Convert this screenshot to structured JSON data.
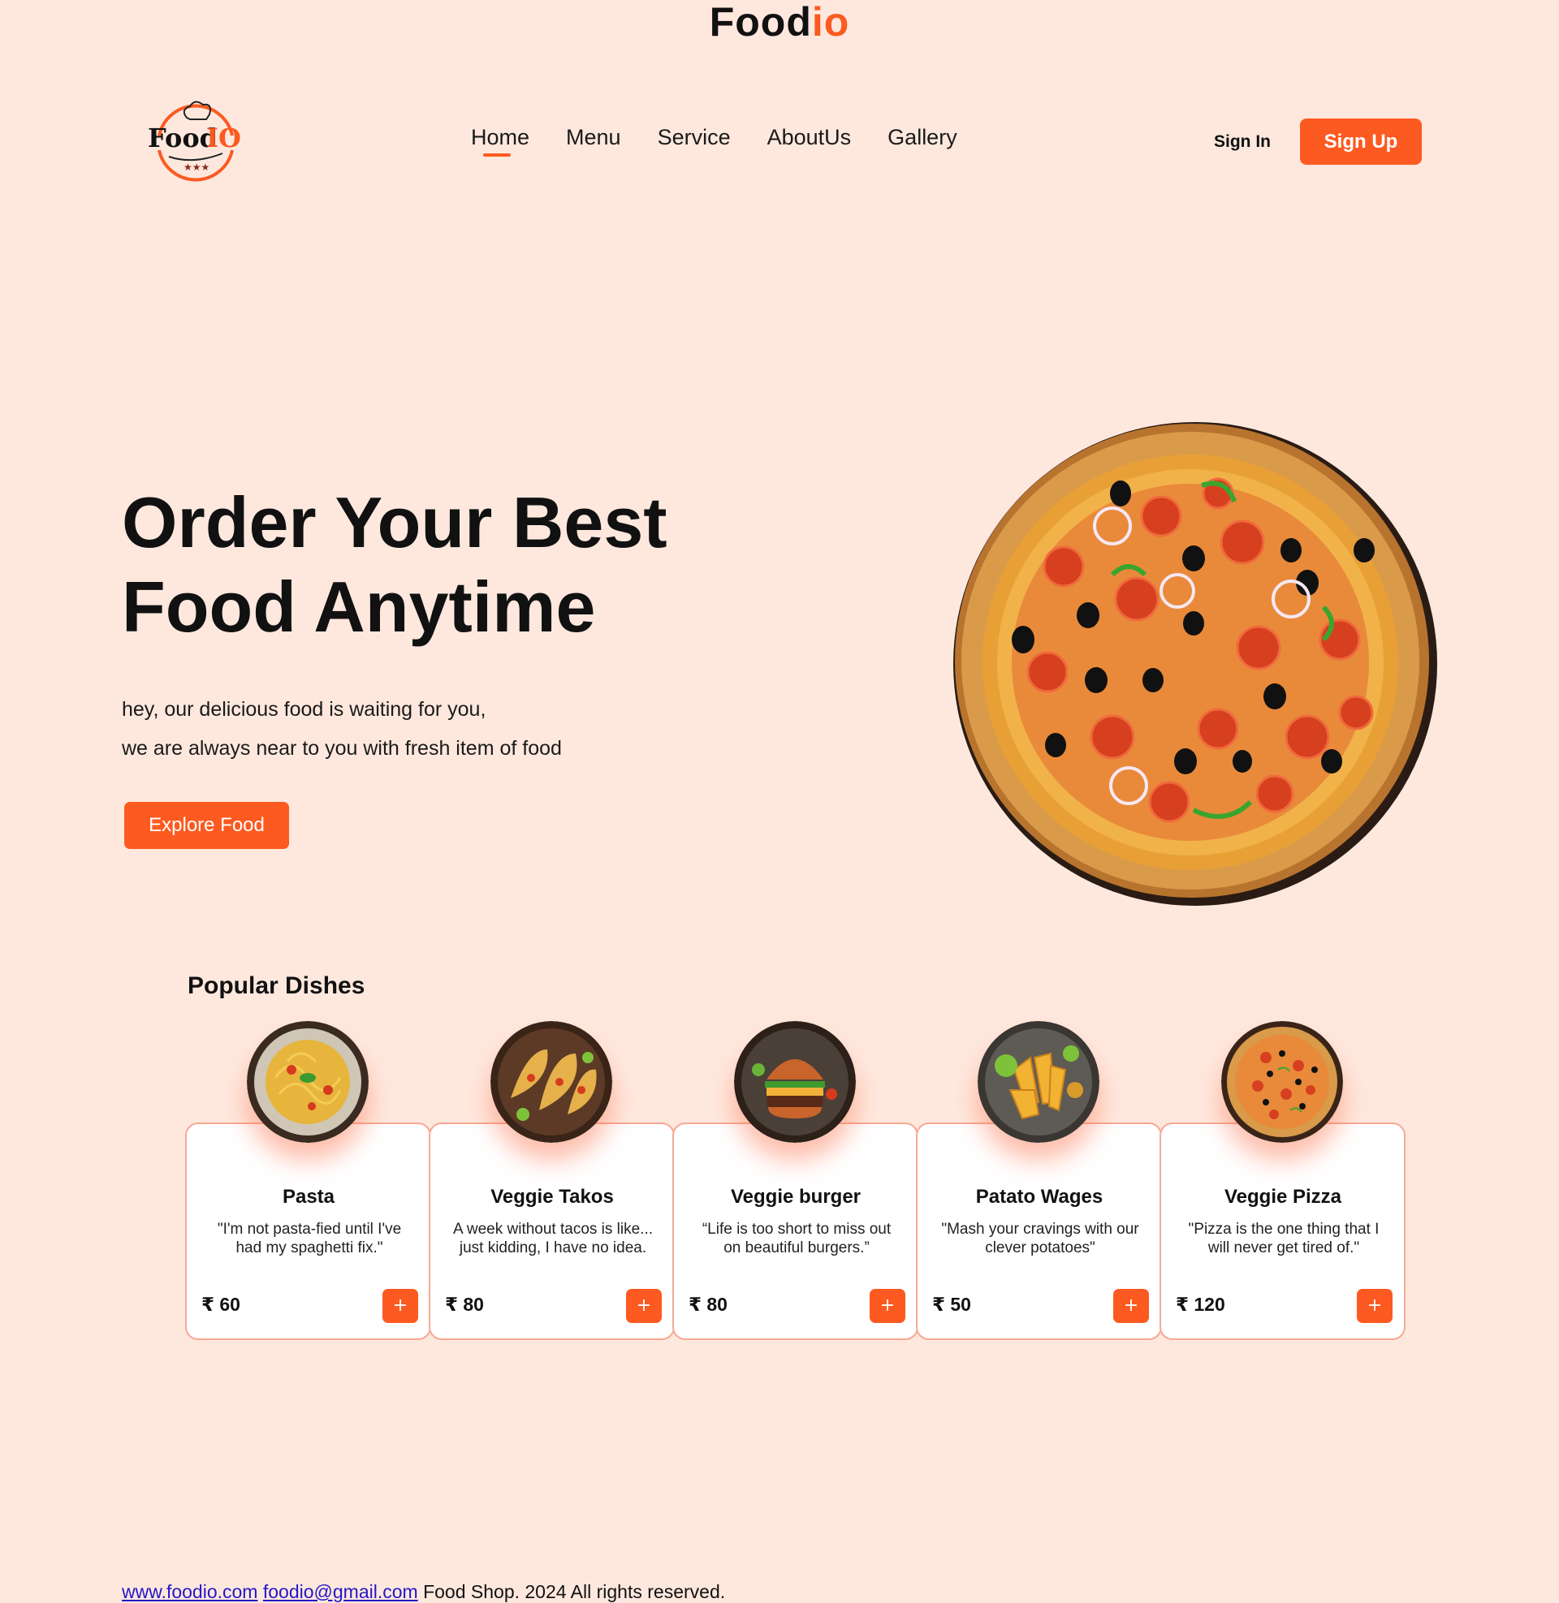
{
  "brand": {
    "prefix": "Food",
    "suffix": "io"
  },
  "logo": {
    "text": "Food",
    "suffix": "IO"
  },
  "nav": [
    {
      "label": "Home",
      "active": true
    },
    {
      "label": "Menu"
    },
    {
      "label": "Service"
    },
    {
      "label": "AboutUs"
    },
    {
      "label": "Gallery"
    }
  ],
  "auth": {
    "sign_in": "Sign In",
    "sign_up": "Sign Up"
  },
  "hero": {
    "title_line1": "Order Your Best",
    "title_line2": "Food Anytime",
    "sub_line1": "hey, our delicious food is waiting for you,",
    "sub_line2": "we are always near to you with fresh item of food",
    "cta": "Explore Food"
  },
  "popular": {
    "title": "Popular Dishes",
    "items": [
      {
        "name": "Pasta",
        "desc": "\"I'm not pasta-fied until I've had my spaghetti fix.\"",
        "price": "₹ 60",
        "add": "+"
      },
      {
        "name": "Veggie Takos",
        "desc": "A week without tacos is like... just kidding, I have no idea.",
        "price": "₹ 80",
        "add": "+"
      },
      {
        "name": "Veggie burger",
        "desc": "“Life is too short to miss out on beautiful burgers.”",
        "price": "₹ 80",
        "add": "+"
      },
      {
        "name": "Patato Wages",
        "desc": "\"Mash your cravings with our clever potatoes\"",
        "price": "₹ 50",
        "add": "+"
      },
      {
        "name": "Veggie Pizza",
        "desc": "\"Pizza is the one thing that I will never get tired of.\"",
        "price": "₹ 120",
        "add": "+"
      }
    ]
  },
  "footer": {
    "link1": "www.foodio.com",
    "link2": "foodio@gmail.com",
    "text": "Food Shop. 2024 All rights reserved."
  },
  "colors": {
    "accent": "#fc5a20",
    "background": "#fee8de"
  }
}
